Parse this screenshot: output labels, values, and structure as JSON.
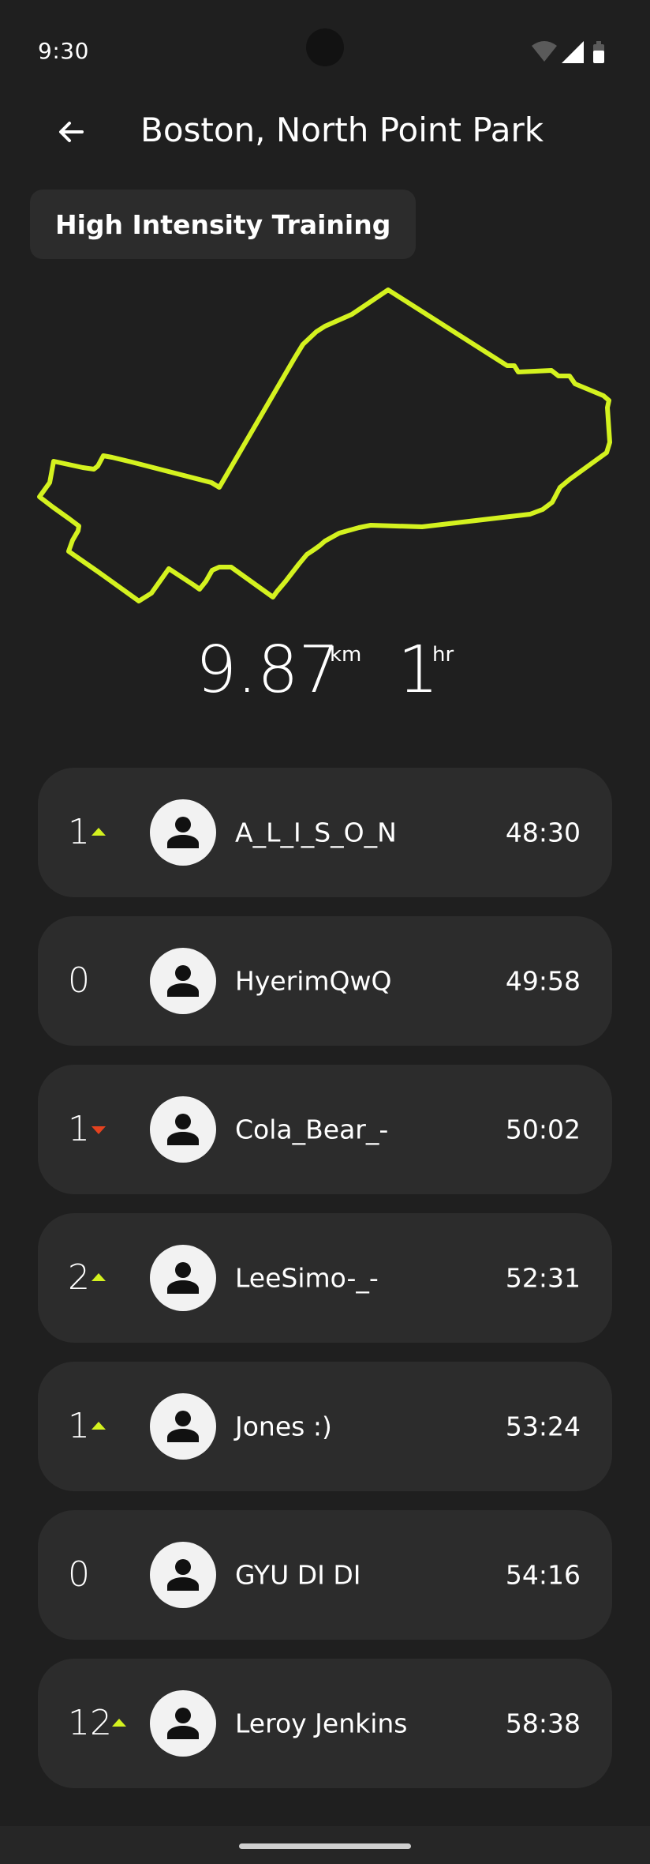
{
  "status_bar": {
    "time": "9:30"
  },
  "header": {
    "back_icon": "arrow-left-icon",
    "title": "Boston, North Point Park"
  },
  "chip": {
    "label": "High Intensity Training"
  },
  "route": {
    "color": "#d4f21f"
  },
  "stats": {
    "distance": "9.87",
    "distance_unit": "km",
    "duration": "1",
    "duration_unit": "hr"
  },
  "colors": {
    "background": "#1f1f1f",
    "card": "#2c2c2c",
    "trend_up": "#d4f21f",
    "trend_down": "#e5421f"
  },
  "leaderboard": [
    {
      "rank_change": "1",
      "trend": "up",
      "name": "A_L_I_S_O_N",
      "time": "48:30"
    },
    {
      "rank_change": "0",
      "trend": "none",
      "name": "HyerimQwQ",
      "time": "49:58"
    },
    {
      "rank_change": "1",
      "trend": "down",
      "name": "Cola_Bear_-",
      "time": "50:02"
    },
    {
      "rank_change": "2",
      "trend": "up",
      "name": "LeeSimo-_-",
      "time": "52:31"
    },
    {
      "rank_change": "1",
      "trend": "up",
      "name": "Jones :)",
      "time": "53:24"
    },
    {
      "rank_change": "0",
      "trend": "none",
      "name": "GYU DI DI",
      "time": "54:16"
    },
    {
      "rank_change": "12",
      "trend": "up",
      "name": "Leroy Jenkins",
      "time": "58:38"
    }
  ]
}
